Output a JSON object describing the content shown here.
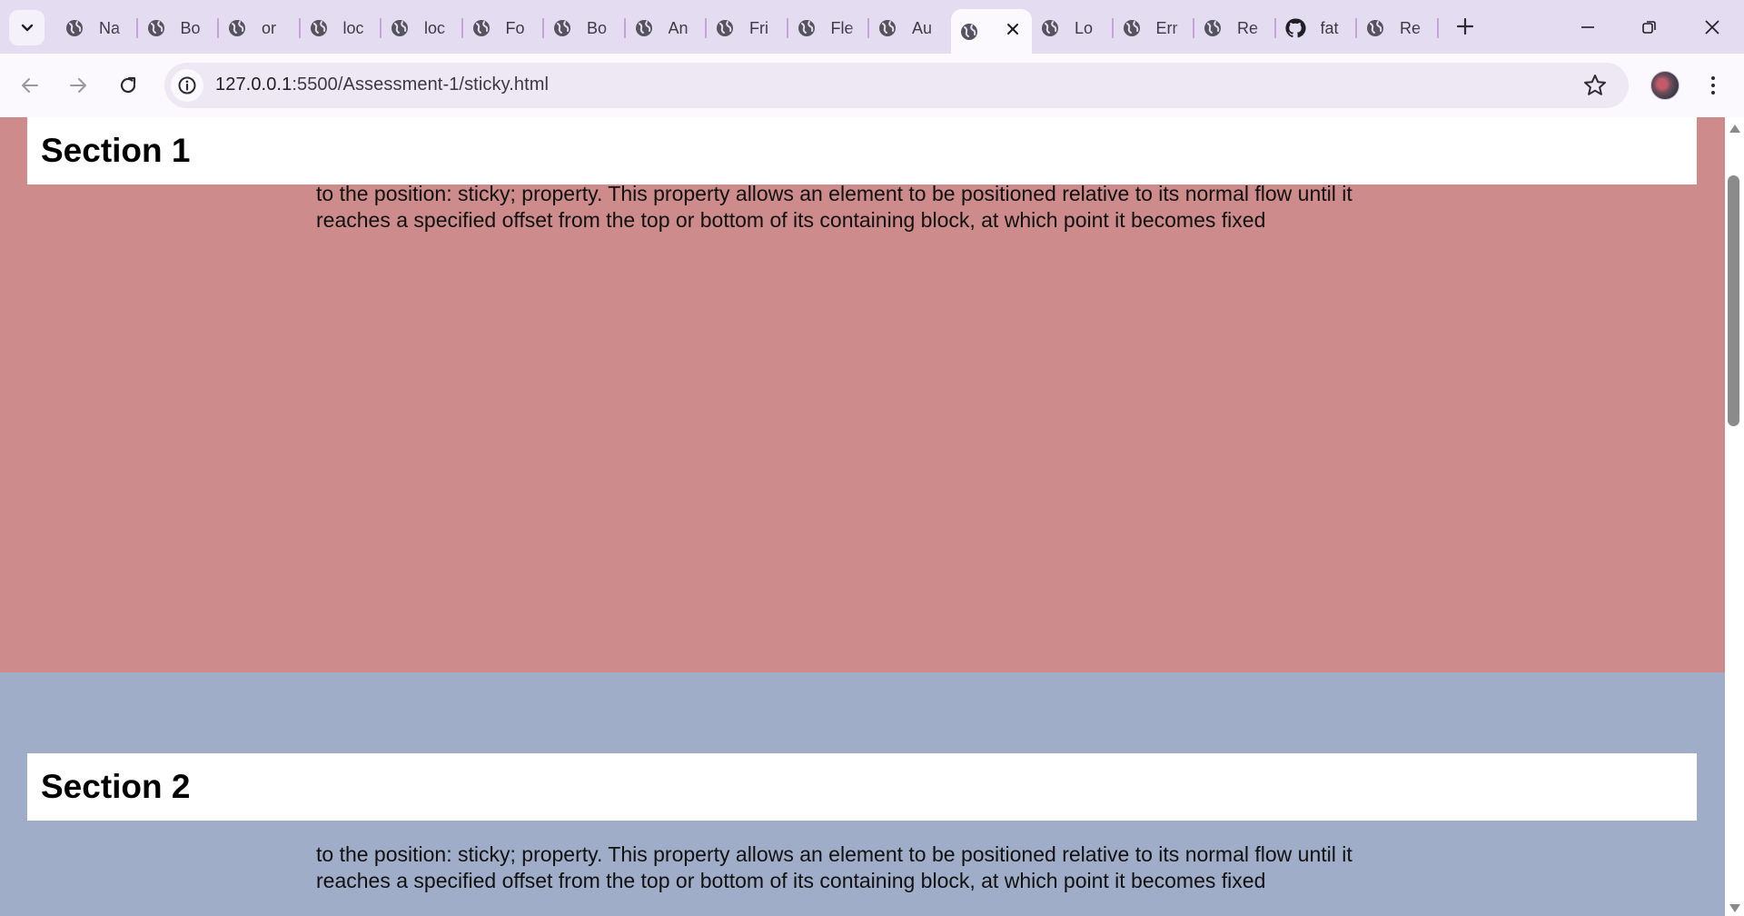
{
  "browser": {
    "tabs": [
      {
        "label": "Na",
        "icon": "globe-icon"
      },
      {
        "label": "Bo",
        "icon": "globe-icon"
      },
      {
        "label": "or",
        "icon": "globe-icon"
      },
      {
        "label": "loc",
        "icon": "globe-icon"
      },
      {
        "label": "loc",
        "icon": "globe-icon"
      },
      {
        "label": "Fo",
        "icon": "globe-icon"
      },
      {
        "label": "Bo",
        "icon": "globe-icon"
      },
      {
        "label": "An",
        "icon": "globe-icon"
      },
      {
        "label": "Fri",
        "icon": "globe-icon"
      },
      {
        "label": "Fle",
        "icon": "globe-icon"
      },
      {
        "label": "Au",
        "icon": "globe-icon"
      },
      {
        "label": "",
        "icon": "globe-icon",
        "active": true
      },
      {
        "label": "Lo",
        "icon": "globe-icon"
      },
      {
        "label": "Err",
        "icon": "globe-icon"
      },
      {
        "label": "Re",
        "icon": "globe-icon"
      },
      {
        "label": "fat",
        "icon": "github-icon"
      },
      {
        "label": "Re",
        "icon": "globe-icon"
      }
    ],
    "url_host": "127.0.0.1",
    "url_path": ":5500/Assessment-1/sticky.html",
    "colors": {
      "frame": "#e4dcf0",
      "toolbar": "#fbf9fd",
      "omnibox": "#ede8f3"
    }
  },
  "page": {
    "section1": {
      "heading": "Section 1",
      "text": "to the position: sticky; property. This property allows an element to be positioned relative to its normal flow until it reaches a specified offset from the top or bottom of its containing block, at which point it becomes fixed",
      "color": "#cd8b8b"
    },
    "section2": {
      "heading": "Section 2",
      "text": "to the position: sticky; property. This property allows an element to be positioned relative to its normal flow until it reaches a specified offset from the top or bottom of its containing block, at which point it becomes fixed",
      "color": "#9fadc8"
    }
  }
}
